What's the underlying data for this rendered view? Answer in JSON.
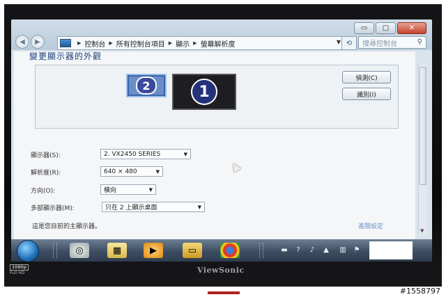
{
  "window": {
    "breadcrumbs": [
      "控制台",
      "所有控制台項目",
      "顯示",
      "螢幕解析度"
    ],
    "search_placeholder": "搜尋控制台",
    "buttons": {
      "minimize": "▭",
      "maximize": "□",
      "close": "✕"
    }
  },
  "page": {
    "title": "變更顯示器的外觀",
    "monitors": {
      "primary_number": "1",
      "secondary_number": "2"
    },
    "detect_button": "偵測(C)",
    "identify_button": "識別(I)",
    "display_label": "顯示器(S):",
    "display_value": "2. VX2450 SERIES",
    "resolution_label": "解析度(R):",
    "resolution_value": "640 × 480",
    "orientation_label": "方向(O):",
    "orientation_value": "橫向",
    "multi_display_label": "多部顯示器(M):",
    "multi_display_value": "只在 2 上顯示桌面",
    "footer_text": "這是您目前的主顯示器。",
    "advanced_link": "進階設定"
  },
  "taskbar": {
    "icons": [
      "start-orb",
      "media-center",
      "file-explorer",
      "media-player",
      "folder",
      "chrome"
    ],
    "tray_icons": [
      "keyboard",
      "help",
      "mic",
      "flag",
      "network",
      "volume"
    ]
  },
  "bezel": {
    "brand": "ViewSonic",
    "hd_badge": "1080p",
    "hd_text": "Full HD"
  },
  "watermark": "#1558797",
  "colors": {
    "accent": "#1c3f7a",
    "taskbar": "#3d4d62",
    "link": "#6a8fc8"
  }
}
